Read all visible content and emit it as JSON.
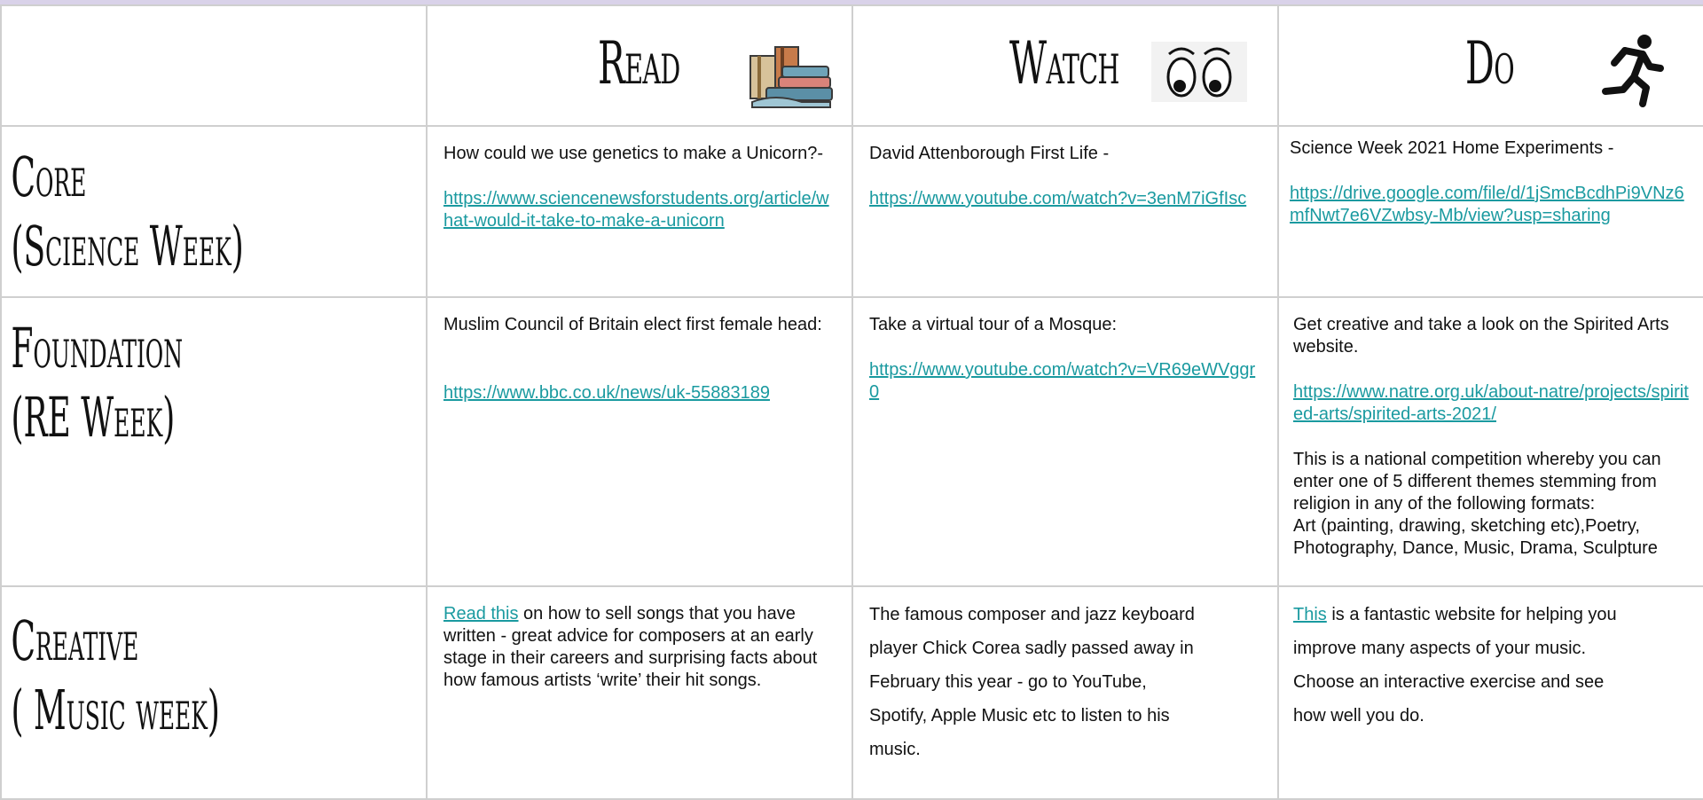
{
  "header": {
    "read": "Read",
    "watch": "Watch",
    "do": "Do"
  },
  "rows": {
    "core": {
      "label_line1": "Core",
      "label_line2": "(Science Week)",
      "read_text": "How could we use genetics to make a Unicorn?-",
      "read_link": "https://www.sciencenewsforstudents.org/article/what-would-it-take-to-make-a-unicorn",
      "watch_text": "David Attenborough First Life -",
      "watch_link": "https://www.youtube.com/watch?v=3enM7iGfIsc",
      "do_text": "Science Week 2021 Home Experiments -",
      "do_link": "https://drive.google.com/file/d/1jSmcBcdhPi9VNz6mfNwt7e6VZwbsy-Mb/view?usp=sharing"
    },
    "foundation": {
      "label_line1": "Foundation",
      "label_line2": "(RE Week)",
      "read_text": "Muslim Council of Britain elect first female head:",
      "read_link": "https://www.bbc.co.uk/news/uk-55883189",
      "watch_text": "Take a virtual tour of a Mosque:",
      "watch_link": "https://www.youtube.com/watch?v=VR69eWVggr0",
      "do_text": "Get creative and take a look on the Spirited Arts website.",
      "do_link": "https://www.natre.org.uk/about-natre/projects/spirited-arts/spirited-arts-2021/",
      "do_text2": "This is a national competition whereby you can enter one of 5 different themes stemming from religion in any of the following formats:",
      "do_text3": "Art (painting, drawing, sketching etc),Poetry, Photography, Dance, Music, Drama, Sculpture"
    },
    "creative": {
      "label_line1": "Creative",
      "label_line2": "( Music week)",
      "read_link_text": "Read this",
      "read_text": " on how to sell songs that you have written - great advice for composers at an early stage in their careers and surprising facts about how famous artists ‘write’ their hit songs.",
      "watch_line1": "The famous composer and jazz keyboard",
      "watch_line2": "player Chick Corea sadly passed away in",
      "watch_line3": "February this year -  go to YouTube,",
      "watch_line4": "Spotify, Apple Music etc to listen to his",
      "watch_line5": "music.",
      "do_link_text": "This",
      "do_line1": " is a fantastic website for helping you",
      "do_line2": "improve many aspects of your music.",
      "do_line3": "Choose an interactive exercise and see",
      "do_line4": "how well you do."
    }
  },
  "icons": {
    "read": "books-icon",
    "watch": "eyes-icon",
    "do": "running-person-icon"
  },
  "colors": {
    "link": "#1a9aa0",
    "top_strip": "#d9d2e9"
  }
}
